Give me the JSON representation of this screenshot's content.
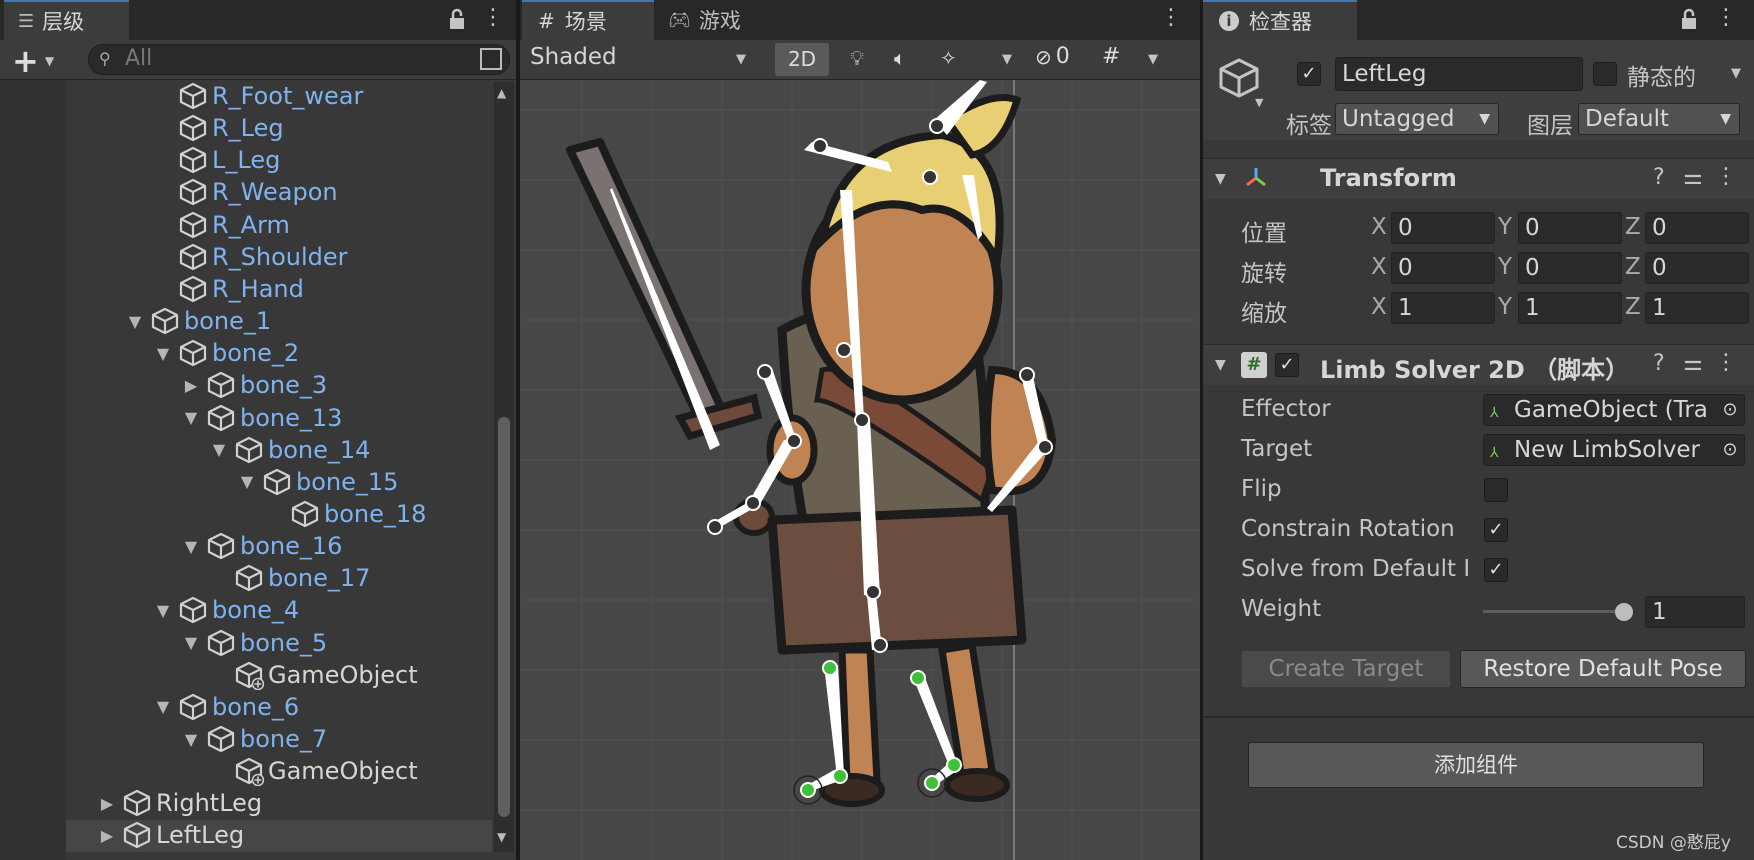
{
  "hierarchy": {
    "tab_label": "层级",
    "add_label": "+",
    "search_placeholder": "All",
    "items": [
      {
        "label": "R_Foot_wear",
        "arrow": ""
      },
      {
        "label": "R_Leg",
        "arrow": ""
      },
      {
        "label": "L_Leg",
        "arrow": ""
      },
      {
        "label": "R_Weapon",
        "arrow": ""
      },
      {
        "label": "R_Arm",
        "arrow": ""
      },
      {
        "label": "R_Shoulder",
        "arrow": ""
      },
      {
        "label": "R_Hand",
        "arrow": ""
      },
      {
        "label": "bone_1",
        "arrow": "▼"
      },
      {
        "label": "bone_2",
        "arrow": "▼"
      },
      {
        "label": "bone_3",
        "arrow": "▶"
      },
      {
        "label": "bone_13",
        "arrow": "▼"
      },
      {
        "label": "bone_14",
        "arrow": "▼"
      },
      {
        "label": "bone_15",
        "arrow": "▼"
      },
      {
        "label": "bone_18",
        "arrow": ""
      },
      {
        "label": "bone_16",
        "arrow": "▼"
      },
      {
        "label": "bone_17",
        "arrow": ""
      },
      {
        "label": "bone_4",
        "arrow": "▼"
      },
      {
        "label": "bone_5",
        "arrow": "▼"
      },
      {
        "label": "GameObject",
        "arrow": ""
      },
      {
        "label": "bone_6",
        "arrow": "▼"
      },
      {
        "label": "bone_7",
        "arrow": "▼"
      },
      {
        "label": "GameObject",
        "arrow": ""
      },
      {
        "label": "RightLeg",
        "arrow": "▶"
      },
      {
        "label": "LeftLeg",
        "arrow": "▶"
      }
    ]
  },
  "scene": {
    "tab_scene": "场景",
    "tab_game": "游戏",
    "shading_mode": "Shaded",
    "mode_2d": "2D",
    "hidden_count": "0"
  },
  "inspector": {
    "tab_label": "检查器",
    "object_name": "LeftLeg",
    "static_label": "静态的",
    "tag_label": "标签",
    "tag_value": "Untagged",
    "layer_label": "图层",
    "layer_value": "Default",
    "transform": {
      "title": "Transform",
      "rows": [
        {
          "label": "位置",
          "x": "0",
          "y": "0",
          "z": "0"
        },
        {
          "label": "旋转",
          "x": "0",
          "y": "0",
          "z": "0"
        },
        {
          "label": "缩放",
          "x": "1",
          "y": "1",
          "z": "1"
        }
      ],
      "axis_x": "X",
      "axis_y": "Y",
      "axis_z": "Z"
    },
    "limb_solver": {
      "title": "Limb Solver 2D （脚本）",
      "effector_label": "Effector",
      "effector_value": "GameObject (Tra",
      "target_label": "Target",
      "target_value": "New LimbSolver",
      "flip_label": "Flip",
      "flip_checked": false,
      "constrain_label": "Constrain Rotation",
      "constrain_checked": true,
      "solve_label": "Solve from Default I",
      "solve_checked": true,
      "weight_label": "Weight",
      "weight_value": "1",
      "weight_fraction": 1.0,
      "create_target_label": "Create Target",
      "restore_label": "Restore Default Pose"
    },
    "add_component_label": "添加组件"
  },
  "watermark": "CSDN @憨屁y"
}
